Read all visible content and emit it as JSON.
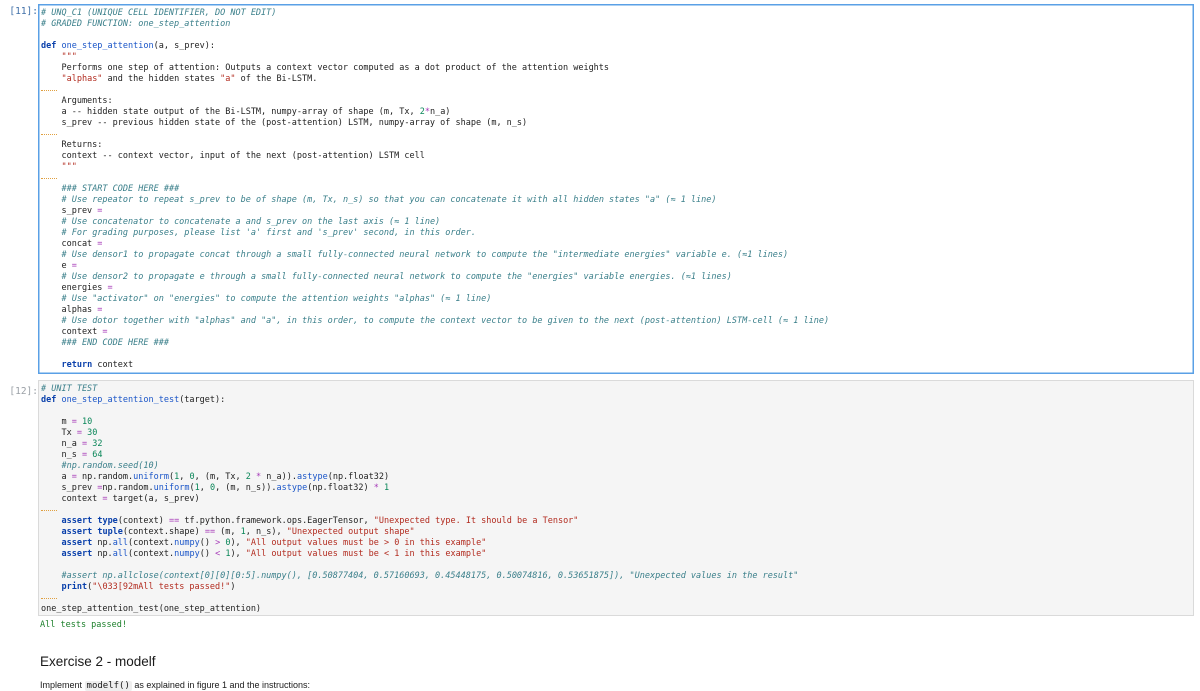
{
  "cell11": {
    "prompt": "[11]:",
    "lines": [
      "# UNQ_C1 (UNIQUE CELL IDENTIFIER, DO NOT EDIT)",
      "# GRADED FUNCTION: one_step_attention",
      "",
      "def one_step_attention(a, s_prev):",
      "    \"\"\"",
      "    Performs one step of attention: Outputs a context vector computed as a dot product of the attention weights",
      "    \"alphas\" and the hidden states \"a\" of the Bi-LSTM.",
      "",
      "    Arguments:",
      "    a -- hidden state output of the Bi-LSTM, numpy-array of shape (m, Tx, 2*n_a)",
      "    s_prev -- previous hidden state of the (post-attention) LSTM, numpy-array of shape (m, n_s)",
      "",
      "    Returns:",
      "    context -- context vector, input of the next (post-attention) LSTM cell",
      "    \"\"\"",
      "",
      "    ### START CODE HERE ###",
      "    # Use repeator to repeat s_prev to be of shape (m, Tx, n_s) so that you can concatenate it with all hidden states \"a\" (≈ 1 line)",
      "    s_prev =",
      "    # Use concatenator to concatenate a and s_prev on the last axis (≈ 1 line)",
      "    # For grading purposes, please list 'a' first and 's_prev' second, in this order.",
      "    concat =",
      "    # Use densor1 to propagate concat through a small fully-connected neural network to compute the \"intermediate energies\" variable e. (≈1 lines)",
      "    e =",
      "    # Use densor2 to propagate e through a small fully-connected neural network to compute the \"energies\" variable energies. (≈1 lines)",
      "    energies =",
      "    # Use \"activator\" on \"energies\" to compute the attention weights \"alphas\" (≈ 1 line)",
      "    alphas =",
      "    # Use dotor together with \"alphas\" and \"a\", in this order, to compute the context vector to be given to the next (post-attention) LSTM-cell (≈ 1 line)",
      "    context =",
      "    ### END CODE HERE ###",
      "",
      "    return context"
    ]
  },
  "cell12": {
    "prompt": "[12]:",
    "lines": [
      "# UNIT TEST",
      "def one_step_attention_test(target):",
      "",
      "    m = 10",
      "    Tx = 30",
      "    n_a = 32",
      "    n_s = 64",
      "    #np.random.seed(10)",
      "    a = np.random.uniform(1, 0, (m, Tx, 2 * n_a)).astype(np.float32)",
      "    s_prev =np.random.uniform(1, 0, (m, n_s)).astype(np.float32) * 1",
      "    context = target(a, s_prev)",
      "",
      "    assert type(context) == tf.python.framework.ops.EagerTensor, \"Unexpected type. It should be a Tensor\"",
      "    assert tuple(context.shape) == (m, 1, n_s), \"Unexpected output shape\"",
      "    assert np.all(context.numpy() > 0), \"All output values must be > 0 in this example\"",
      "    assert np.all(context.numpy() < 1), \"All output values must be < 1 in this example\"",
      "",
      "    #assert np.allclose(context[0][0][0:5].numpy(), [0.50877404, 0.57160693, 0.45448175, 0.50074816, 0.53651875]), \"Unexpected values in the result\"",
      "    print(\"\\033[92mAll tests passed!\")",
      "",
      "one_step_attention_test(one_step_attention)"
    ],
    "output": "All tests passed!"
  },
  "markdown": {
    "title": "Exercise 2 - modelf",
    "text_before": "Implement ",
    "code": "modelf()",
    "text_after": " as explained in figure 1 and the instructions:"
  }
}
